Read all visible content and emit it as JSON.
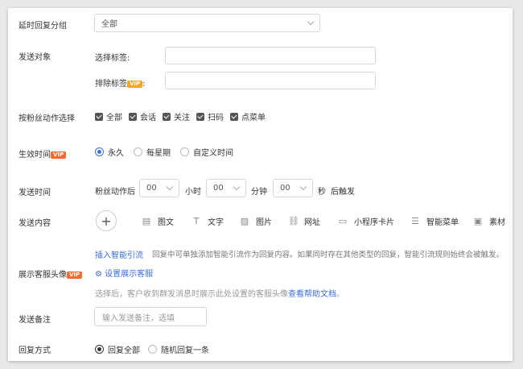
{
  "delay_group": {
    "label": "延时回复分组",
    "value": "全部"
  },
  "target": {
    "label": "发送对象",
    "select_tag_label": "选择标签:",
    "exclude_tag_label": "排除标签",
    "exclude_tag_suffix": ":"
  },
  "vip_badge": "VIP",
  "fan_action": {
    "label": "按粉丝动作选择",
    "options": [
      "全部",
      "会话",
      "关注",
      "扫码",
      "点菜单"
    ]
  },
  "effective_time": {
    "label": "生效时间",
    "options": [
      "永久",
      "每星期",
      "自定义时间"
    ]
  },
  "send_time": {
    "label": "发送时间",
    "prefix": "粉丝动作后",
    "hour_value": "00",
    "hour_unit": "小时",
    "minute_value": "00",
    "minute_unit": "分钟",
    "second_value": "00",
    "second_unit": "秒",
    "suffix": "后触发"
  },
  "content": {
    "label": "发送内容",
    "plus": "+",
    "types": [
      "图文",
      "文字",
      "图片",
      "网址",
      "小程序卡片",
      "智能菜单",
      "素材"
    ],
    "smart_flow_link": "插入智能引流",
    "smart_flow_desc": "回复中可单独添加智能引流作为回复内容。如果同时存在其他类型的回复，智能引流规则始终会被触发。"
  },
  "avatar": {
    "label": "展示客服头像",
    "settings_link": "设置展示客服",
    "desc": "选择后，客户收到群发消息时展示此处设置的客服头像",
    "help_link": "查看帮助文档",
    "desc_end": "。"
  },
  "remark": {
    "label": "发送备注",
    "placeholder": "输入发送备注，选填"
  },
  "reply_mode": {
    "label": "回复方式",
    "options": [
      "回复全部",
      "随机回复一条"
    ]
  }
}
